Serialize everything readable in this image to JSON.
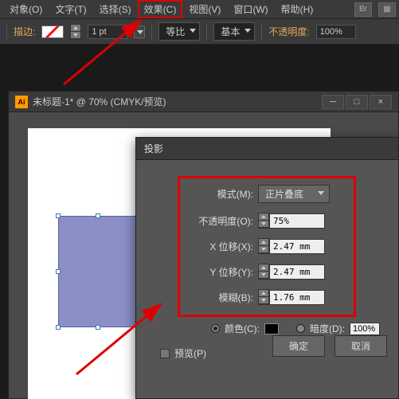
{
  "menu": {
    "object": "对象(O)",
    "text": "文字(T)",
    "select": "选择(S)",
    "effect": "效果(C)",
    "view": "视图(V)",
    "window": "窗口(W)",
    "help": "帮助(H)",
    "br": "Br"
  },
  "toolbar": {
    "stroke_label": "描边:",
    "stroke_value": "1 pt",
    "ratio_label": "等比",
    "basic_label": "基本",
    "opacity_label": "不透明度:",
    "opacity_value": "100%"
  },
  "doc": {
    "title": "未标题-1* @ 70% (CMYK/预览)"
  },
  "dialog": {
    "title": "投影",
    "mode_label": "模式(M):",
    "mode_value": "正片叠底",
    "opacity_label": "不透明度(O):",
    "opacity_value": "75%",
    "x_label": "X 位移(X):",
    "x_value": "2.47 mm",
    "y_label": "Y 位移(Y):",
    "y_value": "2.47 mm",
    "blur_label": "模糊(B):",
    "blur_value": "1.76 mm",
    "color_label": "颜色(C):",
    "darkness_label": "暗度(D):",
    "darkness_value": "100%",
    "preview_label": "预览(P)",
    "ok": "确定",
    "cancel": "取消"
  }
}
